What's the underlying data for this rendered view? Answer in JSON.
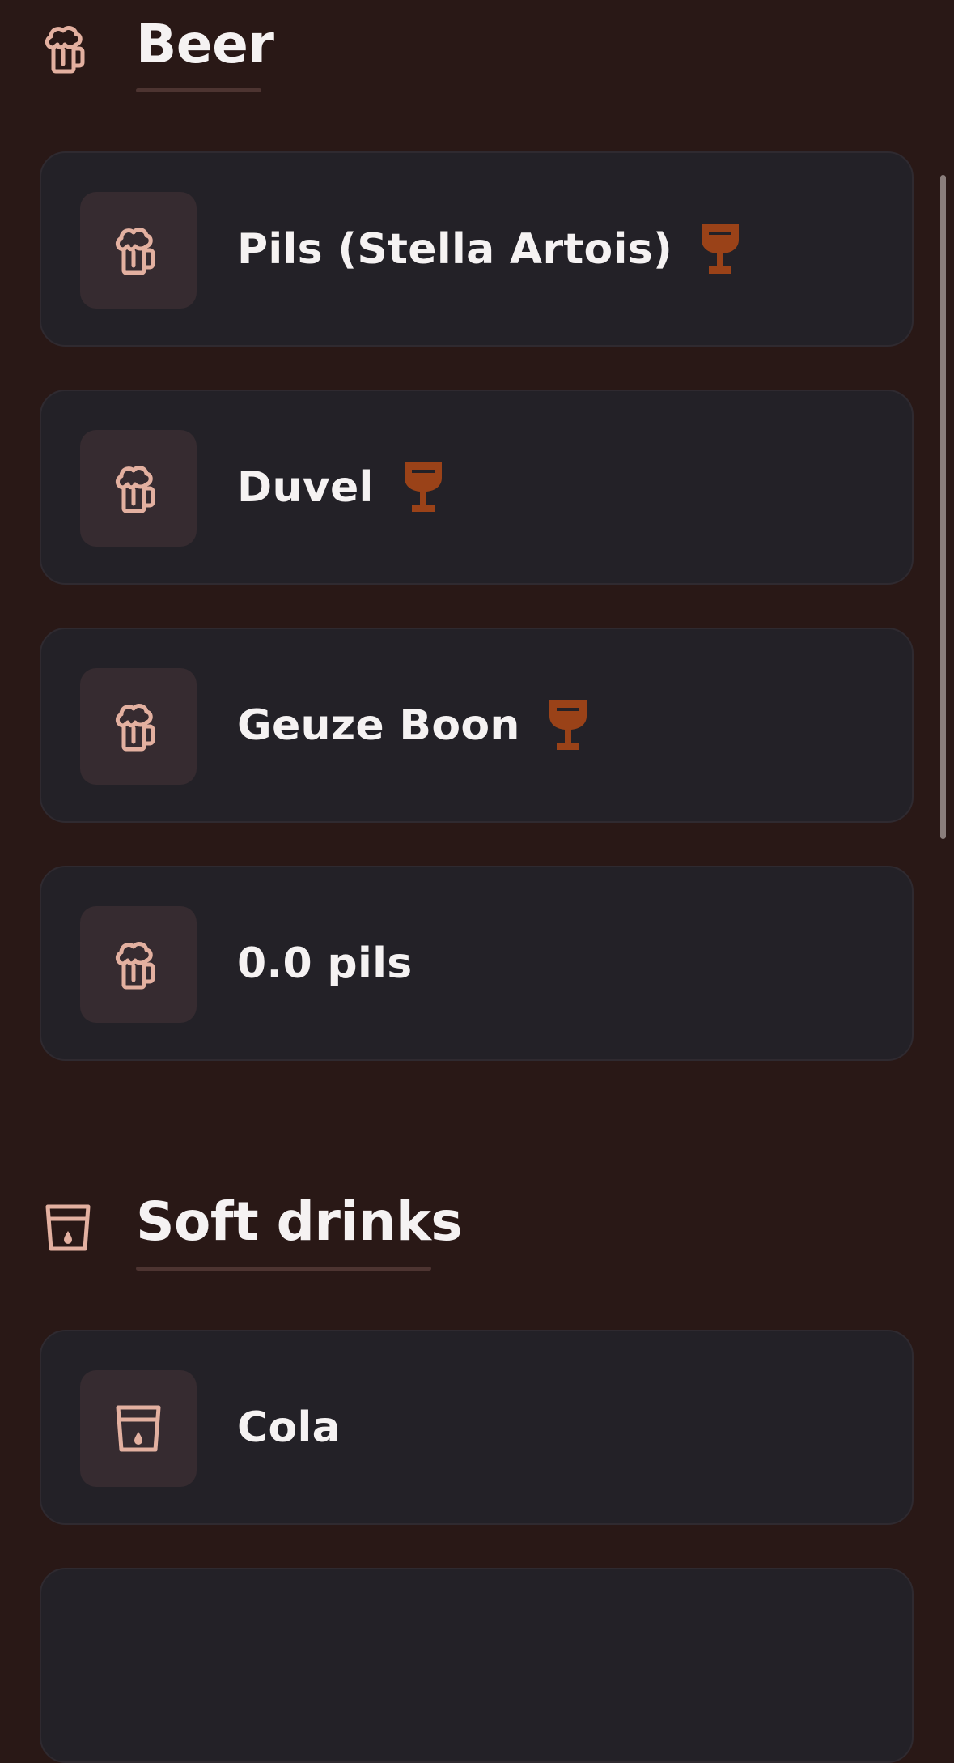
{
  "sections": [
    {
      "title": "Beer",
      "icon": "beer-mug-icon",
      "items": [
        {
          "label": "Pils (Stella Artois)",
          "icon": "beer-mug-icon",
          "badge_icon": "wine-glass-icon"
        },
        {
          "label": "Duvel",
          "icon": "beer-mug-icon",
          "badge_icon": "wine-glass-icon"
        },
        {
          "label": "Geuze Boon",
          "icon": "beer-mug-icon",
          "badge_icon": "wine-glass-icon"
        },
        {
          "label": "0.0 pils",
          "icon": "beer-mug-icon"
        }
      ]
    },
    {
      "title": "Soft drinks",
      "icon": "soft-drink-cup-icon",
      "items": [
        {
          "label": "Cola",
          "icon": "soft-drink-cup-icon"
        }
      ]
    }
  ],
  "colors": {
    "background": "#291816",
    "card": "#232127",
    "icon_box": "#362b30",
    "icon": "#e3b0a0",
    "glass_badge": "#9a4218",
    "text": "#f5f2f2"
  }
}
